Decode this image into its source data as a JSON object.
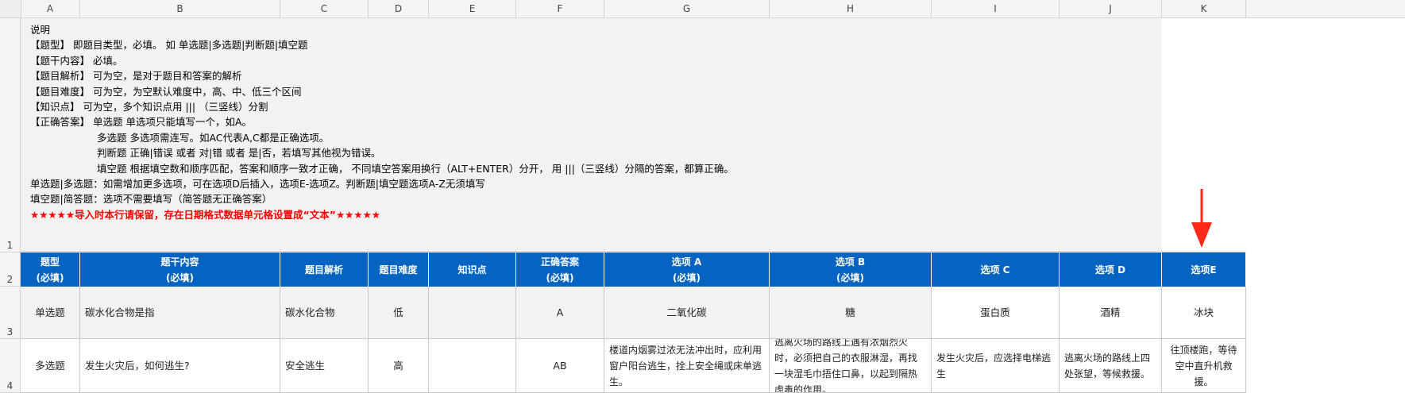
{
  "columns": [
    "A",
    "B",
    "C",
    "D",
    "E",
    "F",
    "G",
    "H",
    "I",
    "J",
    "K"
  ],
  "rows": [
    "1",
    "2",
    "3",
    "4"
  ],
  "notes": {
    "title": "说明",
    "lines": [
      "【题型】  即题目类型，必填。 如 单选题|多选题|判断题|填空题",
      "【题干内容】  必填。",
      "【题目解析】  可为空，是对于题目和答案的解析",
      "【题目难度】  可为空，为空默认难度中，高、中、低三个区间",
      "【知识点】  可为空，多个知识点用 ||| （三竖线）分割",
      "【正确答案】      单选题 单选项只能填写一个，如A。"
    ],
    "indented": [
      "多选题 多选项需连写。如AC代表A,C都是正确选项。",
      "判断题 正确|错误 或者 对|错 或者 是|否，若填写其他视为错误。",
      "填空题 根据填空数和顺序匹配，答案和顺序一致才正确，  不同填空答案用换行（ALT+ENTER）分开， 用 |||（三竖线）分隔的答案，都算正确。"
    ],
    "tail": [
      "单选题|多选题：如需增加更多选项，可在选项D后插入，选项E-选项Z。判断题|填空题选项A-Z无须填写",
      "填空题|简答题：选项不需要填写（简答题无正确答案）"
    ],
    "warning": "★★★★★导入时本行请保留，存在日期格式数据单元格设置成“文本”★★★★★"
  },
  "headers": [
    {
      "l1": "题型",
      "l2": "(必填)"
    },
    {
      "l1": "题干内容",
      "l2": "(必填)"
    },
    {
      "l1": "题目解析",
      "l2": ""
    },
    {
      "l1": "题目难度",
      "l2": ""
    },
    {
      "l1": "知识点",
      "l2": ""
    },
    {
      "l1": "正确答案",
      "l2": "(必填)"
    },
    {
      "l1": "选项 A",
      "l2": "(必填)"
    },
    {
      "l1": "选项 B",
      "l2": "(必填)"
    },
    {
      "l1": "选项 C",
      "l2": ""
    },
    {
      "l1": "选项 D",
      "l2": ""
    },
    {
      "l1": "选项E",
      "l2": ""
    }
  ],
  "data_rows": [
    [
      "单选题",
      "碳水化合物是指",
      "碳水化合物",
      "低",
      "",
      "A",
      "二氧化碳",
      "糖",
      "蛋白质",
      "酒精",
      "冰块"
    ],
    [
      "多选题",
      "发生火灾后，如何逃生?",
      "安全逃生",
      "高",
      "",
      "AB",
      "楼道内烟雾过浓无法冲出时，应利用窗户阳台逃生，拴上安全绳或床单逃生。",
      "逃离火场的路线上遇有浓烟烈火时，必须把自己的衣服淋湿，再找一块湿毛巾捂住口鼻，以起到隔热虑毒的作用。",
      "发生火灾后，应选择电梯逃生",
      "逃离火场的路线上四处张望，等候救援。",
      "往顶楼跑，等待空中直升机救援。"
    ]
  ],
  "colors": {
    "header_bg": "#0563c1",
    "warning": "#ff0000",
    "arrow": "#ff2a1a"
  }
}
